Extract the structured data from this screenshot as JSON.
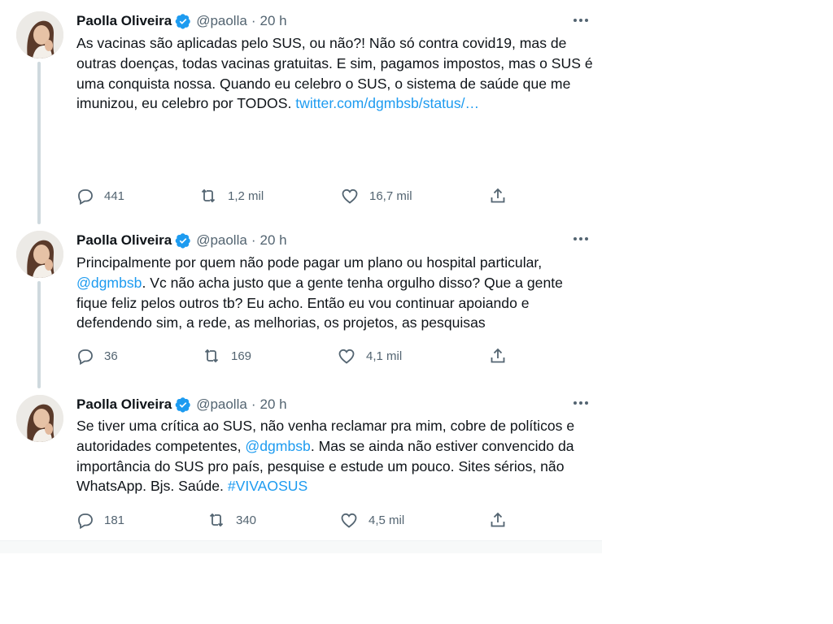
{
  "colors": {
    "link": "#1d9bf0",
    "secondary": "#536471",
    "thread_line": "#cfd9de",
    "verified": "#1d9bf0"
  },
  "tweets": [
    {
      "author": "Paolla Oliveira",
      "handle": "@paolla",
      "separator": "·",
      "time": "20 h",
      "text_parts": [
        {
          "text": "As vacinas são aplicadas pelo SUS, ou não?! Não só contra covid19, mas de outras doenças, todas vacinas gratuitas. E sim, pagamos impostos, mas o SUS é uma conquista nossa. Quando eu celebro o SUS, o sistema de saúde que me imunizou, eu celebro por TODOS. "
        },
        {
          "text": "twitter.com/dgmbsb/status/…",
          "link": true
        }
      ],
      "replies": "441",
      "retweets": "1,2 mil",
      "likes": "16,7 mil"
    },
    {
      "author": "Paolla Oliveira",
      "handle": "@paolla",
      "separator": "·",
      "time": "20 h",
      "text_parts": [
        {
          "text": "Principalmente por quem não pode pagar um plano ou hospital particular, "
        },
        {
          "text": "@dgmbsb",
          "link": true
        },
        {
          "text": ". Vc não acha justo que a gente tenha orgulho disso? Que a gente fique feliz pelos outros tb? Eu acho. Então eu vou continuar apoiando e defendendo sim, a rede, as melhorias, os projetos, as pesquisas"
        }
      ],
      "replies": "36",
      "retweets": "169",
      "likes": "4,1 mil"
    },
    {
      "author": "Paolla Oliveira",
      "handle": "@paolla",
      "separator": "·",
      "time": "20 h",
      "text_parts": [
        {
          "text": "Se tiver uma crítica ao SUS, não venha reclamar pra mim, cobre de políticos e autoridades competentes, "
        },
        {
          "text": "@dgmbsb",
          "link": true
        },
        {
          "text": ". Mas se ainda não estiver convencido da importância do SUS pro país, pesquise e estude um pouco. Sites sérios, não WhatsApp. Bjs. Saúde. "
        },
        {
          "text": "#VIVAOSUS",
          "link": true
        }
      ],
      "replies": "181",
      "retweets": "340",
      "likes": "4,5 mil"
    }
  ],
  "icons": {
    "reply": "reply-icon",
    "retweet": "retweet-icon",
    "like": "heart-icon",
    "share": "share-icon",
    "more": "more-icon",
    "verified": "verified-badge-icon"
  }
}
